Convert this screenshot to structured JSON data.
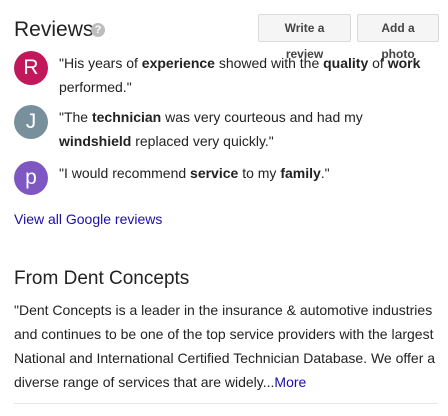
{
  "reviews": {
    "title": "Reviews",
    "help_icon": "question-circle-icon",
    "write_review_label": "Write a review",
    "add_photo_label": "Add a photo",
    "items": [
      {
        "initial": "R",
        "avatar_color": "#c2185b",
        "segments": [
          {
            "text": "\"His years of ",
            "bold": false
          },
          {
            "text": "experience",
            "bold": true
          },
          {
            "text": " showed with the ",
            "bold": false
          },
          {
            "text": "quality",
            "bold": true
          },
          {
            "text": " of ",
            "bold": false
          },
          {
            "text": "work",
            "bold": true
          },
          {
            "text": " performed.\"",
            "bold": false
          }
        ]
      },
      {
        "initial": "J",
        "avatar_color": "#78909c",
        "segments": [
          {
            "text": "\"The ",
            "bold": false
          },
          {
            "text": "technician",
            "bold": true
          },
          {
            "text": " was very courteous and had my ",
            "bold": false
          },
          {
            "text": "windshield",
            "bold": true
          },
          {
            "text": " replaced very quickly.\"",
            "bold": false
          }
        ]
      },
      {
        "initial": "p",
        "avatar_color": "#7e57c2",
        "segments": [
          {
            "text": "\"I would recommend ",
            "bold": false
          },
          {
            "text": "service",
            "bold": true
          },
          {
            "text": " to my ",
            "bold": false
          },
          {
            "text": "family",
            "bold": true
          },
          {
            "text": ".\"",
            "bold": false
          }
        ]
      }
    ],
    "view_all_label": "View all Google reviews"
  },
  "from_business": {
    "title": "From Dent Concepts",
    "description": "\"Dent Concepts is a leader in the insurance & automotive industries and continues to be one of the top service providers with the largest National and International Certified Technician Database. We offer a diverse range of services that are widely...",
    "more_label": "More"
  },
  "colors": {
    "link": "#1a0dab",
    "text": "#222222"
  }
}
